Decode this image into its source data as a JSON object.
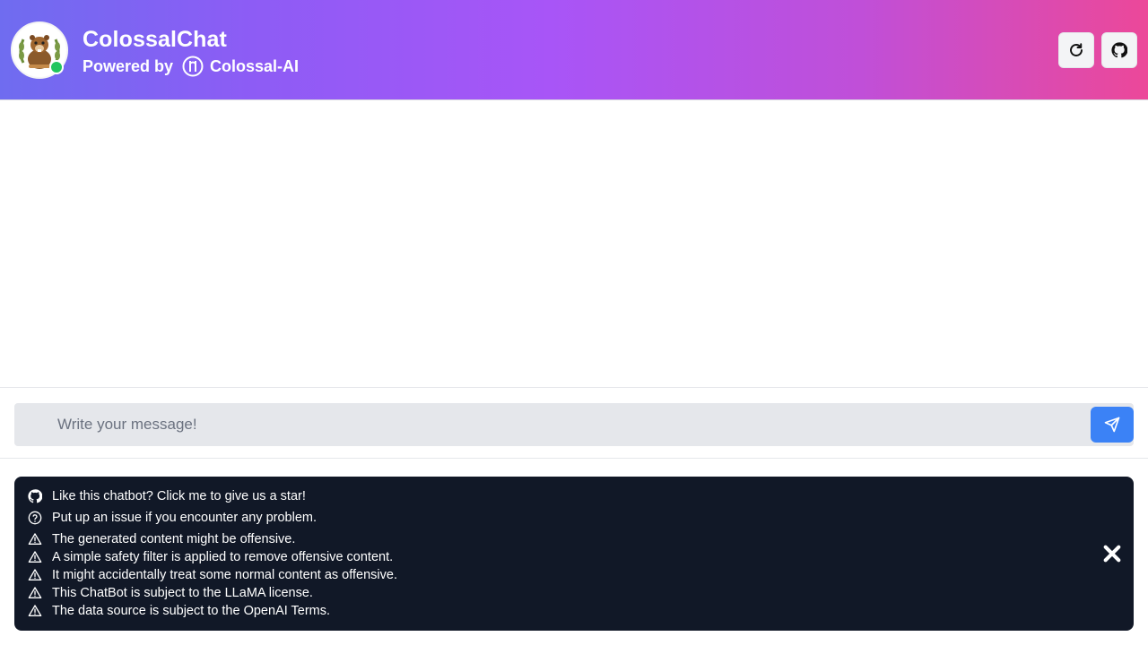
{
  "header": {
    "title": "ColossalChat",
    "powered_by": "Powered by",
    "brand": "Colossal-AI",
    "avatar_icon": "beaver-avatar-icon",
    "status_color": "#22c55e",
    "gradient": [
      "#6f6cf0",
      "#a855f7",
      "#ec4899"
    ],
    "buttons": [
      {
        "name": "refresh-button",
        "icon": "refresh-icon"
      },
      {
        "name": "github-button",
        "icon": "github-icon"
      }
    ]
  },
  "composer": {
    "placeholder": "Write your message!",
    "value": "",
    "send_icon": "send-icon",
    "send_color": "#3b82f6"
  },
  "notices": {
    "background": "#111827",
    "items": [
      {
        "icon": "github-icon",
        "text": "Like this chatbot? Click me to give us a star!"
      },
      {
        "icon": "question-icon",
        "text": "Put up an issue if you encounter any problem."
      },
      {
        "icon": "warning-icon",
        "text": "The generated content might be offensive."
      },
      {
        "icon": "warning-icon",
        "text": "A simple safety filter is applied to remove offensive content."
      },
      {
        "icon": "warning-icon",
        "text": "It might accidentally treat some normal content as offensive."
      },
      {
        "icon": "warning-icon",
        "text": "This ChatBot is subject to the LLaMA license."
      },
      {
        "icon": "warning-icon",
        "text": "The data source is subject to the OpenAI Terms."
      }
    ],
    "close_icon": "close-icon"
  }
}
